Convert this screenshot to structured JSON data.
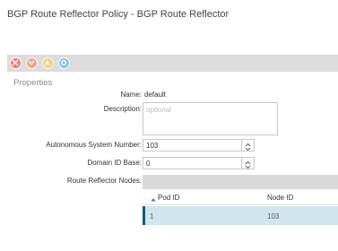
{
  "window": {
    "title": "BGP Route Reflector Policy - BGP Route Reflector"
  },
  "faults": [
    {
      "name": "critical",
      "icon": "x-circle-icon",
      "color": "#ef7b7b"
    },
    {
      "name": "major",
      "icon": "chevron-down-circle-icon",
      "color": "#f2a488"
    },
    {
      "name": "minor",
      "icon": "warning-triangle-icon",
      "color": "#f3cf7d"
    },
    {
      "name": "warning",
      "icon": "info-circle-icon",
      "color": "#83c8e4"
    }
  ],
  "properties": {
    "heading": "Properties",
    "name_label": "Name:",
    "name_value": "default",
    "description_label": "Description:",
    "description_placeholder": "optional",
    "description_value": "",
    "asn_label": "Autonomous System Number:",
    "asn_value": "103",
    "domain_label": "Domain ID Base:",
    "domain_value": "0",
    "nodes_label": "Route Reflector Nodes:"
  },
  "nodes_table": {
    "columns": [
      "Pod ID",
      "Node ID"
    ],
    "sorted_column": "Pod ID",
    "rows": [
      {
        "pod_id": "1",
        "node_id": "103"
      }
    ]
  },
  "colors": {
    "selected_row": "#cfe6ef",
    "selected_marker": "#0d5a84",
    "toolbar": "#dcdcdc"
  }
}
